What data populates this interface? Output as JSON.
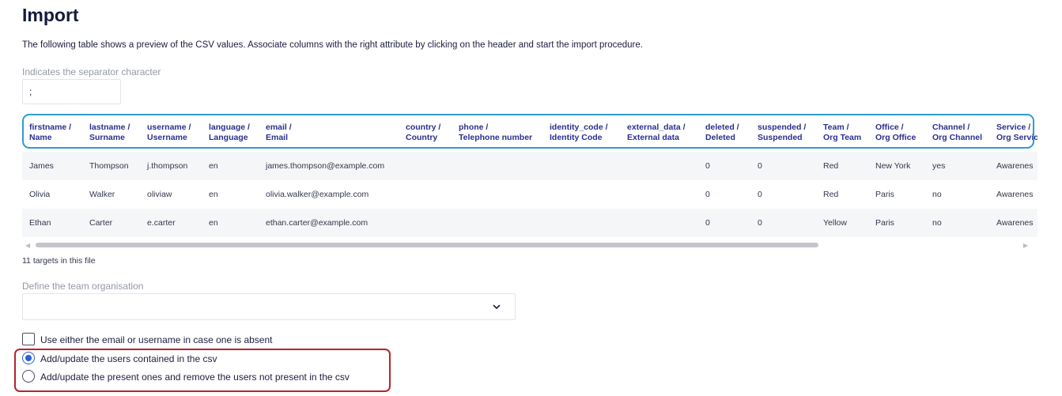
{
  "page": {
    "title": "Import",
    "description": "The following table shows a preview of the CSV values. Associate columns with the right attribute by clicking on the header and start the import procedure."
  },
  "separator": {
    "label": "Indicates the separator character",
    "value": ";"
  },
  "table": {
    "columns": [
      {
        "line1": "firstname /",
        "line2": "Name"
      },
      {
        "line1": "lastname /",
        "line2": "Surname"
      },
      {
        "line1": "username /",
        "line2": "Username"
      },
      {
        "line1": "language /",
        "line2": "Language"
      },
      {
        "line1": "email /",
        "line2": "Email"
      },
      {
        "line1": "country /",
        "line2": "Country"
      },
      {
        "line1": "phone /",
        "line2": "Telephone number"
      },
      {
        "line1": "identity_code /",
        "line2": "Identity Code"
      },
      {
        "line1": "external_data /",
        "line2": "External data"
      },
      {
        "line1": "deleted /",
        "line2": "Deleted"
      },
      {
        "line1": "suspended /",
        "line2": "Suspended"
      },
      {
        "line1": "Team /",
        "line2": "Org Team"
      },
      {
        "line1": "Office /",
        "line2": "Org Office"
      },
      {
        "line1": "Channel /",
        "line2": "Org Channel"
      },
      {
        "line1": "Service /",
        "line2": "Org Servic"
      }
    ],
    "rows": [
      [
        "James",
        "Thompson",
        "j.thompson",
        "en",
        "james.thompson@example.com",
        "",
        "",
        "",
        "",
        "0",
        "0",
        "Red",
        "New York",
        "yes",
        "Awarenes"
      ],
      [
        "Olivia",
        "Walker",
        "oliviaw",
        "en",
        "olivia.walker@example.com",
        "",
        "",
        "",
        "",
        "0",
        "0",
        "Red",
        "Paris",
        "no",
        "Awarenes"
      ],
      [
        "Ethan",
        "Carter",
        "e.carter",
        "en",
        "ethan.carter@example.com",
        "",
        "",
        "",
        "",
        "0",
        "0",
        "Yellow",
        "Paris",
        "no",
        "Awarenes"
      ]
    ]
  },
  "targets_count": "11 targets in this file",
  "team_org": {
    "label": "Define the team organisation",
    "value": ""
  },
  "options": {
    "email_or_username": {
      "label": "Use either the email or username in case one is absent",
      "checked": false
    },
    "mode": {
      "selected": 0,
      "choices": [
        "Add/update the users contained in the csv",
        "Add/update the present ones and remove the users not present in the csv"
      ]
    }
  },
  "colors": {
    "header_outline": "#2f9bd3",
    "radio_group_outline": "#b8232f",
    "radio_selected": "#2c5fd6",
    "header_text": "#2b2f8f"
  },
  "icons": {
    "select_caret": "chevron-down-icon"
  }
}
